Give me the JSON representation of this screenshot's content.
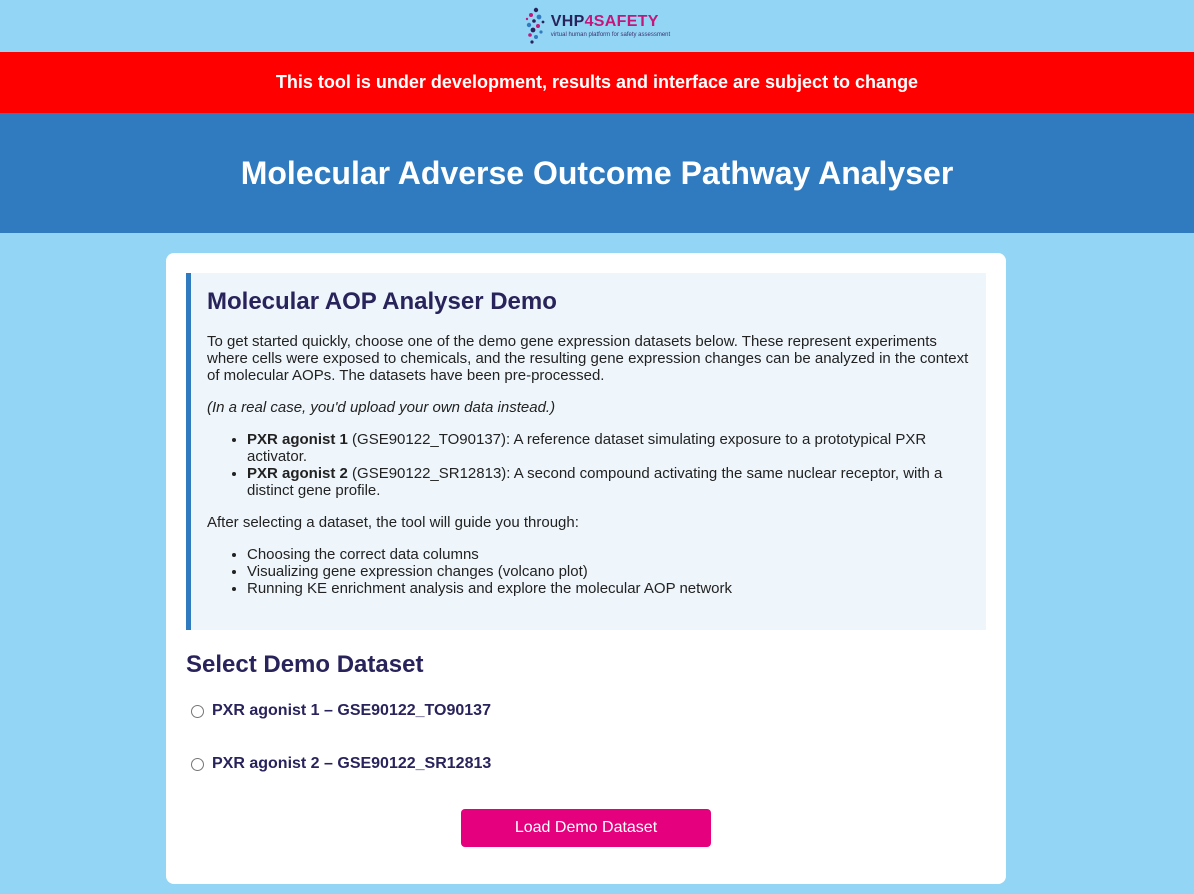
{
  "header": {
    "logo_name_part1": "VHP",
    "logo_name_part2": "4SAFETY",
    "logo_tagline": "virtual human platform for safety assessment"
  },
  "banner": {
    "text": "This tool is under development, results and interface are subject to change"
  },
  "hero": {
    "title": "Molecular Adverse Outcome Pathway Analyser"
  },
  "intro": {
    "title": "Molecular AOP Analyser Demo",
    "paragraph1": "To get started quickly, choose one of the demo gene expression datasets below. These represent experiments where cells were exposed to chemicals, and the resulting gene expression changes can be analyzed in the context of molecular AOPs. The datasets have been pre-processed.",
    "note": "(In a real case, you'd upload your own data instead.)",
    "datasets": [
      {
        "name": "PXR agonist 1",
        "detail": " (GSE90122_TO90137): A reference dataset simulating exposure to a prototypical PXR activator."
      },
      {
        "name": "PXR agonist 2",
        "detail": " (GSE90122_SR12813): A second compound activating the same nuclear receptor, with a distinct gene profile."
      }
    ],
    "steps_intro": "After selecting a dataset, the tool will guide you through:",
    "steps": [
      "Choosing the correct data columns",
      "Visualizing gene expression changes (volcano plot)",
      "Running KE enrichment analysis and explore the molecular AOP network"
    ]
  },
  "select": {
    "title": "Select Demo Dataset",
    "options": [
      {
        "label": "PXR agonist 1 – GSE90122_TO90137",
        "selected": false
      },
      {
        "label": "PXR agonist 2 – GSE90122_SR12813",
        "selected": false
      }
    ],
    "button_label": "Load Demo Dataset"
  },
  "colors": {
    "page_background": "#93d5f5",
    "banner": "#ff0000",
    "hero": "#307bbf",
    "accent_button": "#e5007e",
    "heading_text": "#29235c"
  }
}
